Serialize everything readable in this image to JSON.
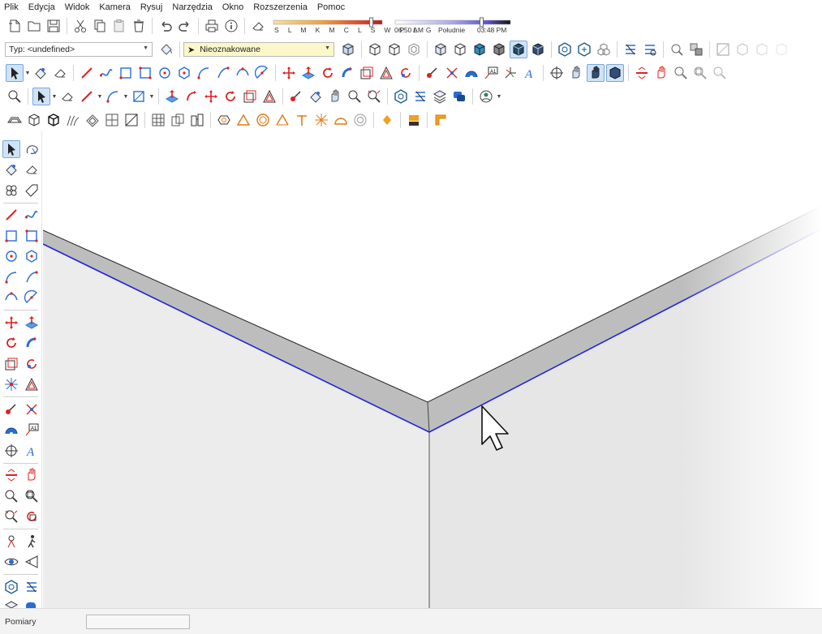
{
  "menu": [
    "Plik",
    "Edycja",
    "Widok",
    "Kamera",
    "Rysuj",
    "Narzędzia",
    "Okno",
    "Rozszerzenia",
    "Pomoc"
  ],
  "shadows": {
    "month_letters": "S L M K M C L S W P L G",
    "time_start": "06:50 AM",
    "time_middle": "Południe",
    "time_end": "03:48 PM",
    "date_slider_level": 0.9,
    "time_slider_level": 0.75
  },
  "style_combo": {
    "value": "Typ: <undefined>"
  },
  "tag_combo": {
    "value": "Nieoznakowane"
  },
  "status": {
    "label": "Pomiary",
    "value": ""
  },
  "colors": {
    "selection_edge": "#2222dd",
    "wall_left": "#ececec",
    "wall_right": "#e6e6e6",
    "wall_top": "#bdbdbd",
    "accent_red": "#e02020",
    "accent_blue": "#2a6bd6"
  },
  "icons": {
    "row1": [
      "new-file-icon",
      "open-folder-icon",
      "save-icon",
      "cut-icon",
      "copy-icon",
      "paste-icon",
      "delete-icon",
      "undo-icon",
      "redo-icon",
      "print-icon",
      "model-info-icon",
      "eraser-icon"
    ],
    "row2": [
      "paint-bucket-icon",
      "style-preview-icon",
      "select-arrow-icon",
      "xray-icon",
      "back-edges-icon",
      "wireframe-icon",
      "hidden-line-icon",
      "shaded-icon",
      "textured-icon",
      "monochrome-icon",
      "section-plane-icon",
      "section-cut-icon",
      "section-fill-icon",
      "camera-icon",
      "component-icon"
    ],
    "row3": [
      "select-icon",
      "paint-icon",
      "eraser-icon",
      "line-icon",
      "freehand-icon",
      "rectangle-icon",
      "rotated-rect-icon",
      "circle-icon",
      "polygon-icon",
      "arc-icon",
      "two-point-arc-icon",
      "three-point-arc-icon",
      "pie-icon",
      "move-icon",
      "push-pull-icon",
      "rotate-icon",
      "follow-me-icon",
      "scale-icon",
      "offset-icon",
      "tape-measure-icon",
      "dimension-icon",
      "protractor-icon",
      "text-icon",
      "axes-icon",
      "3d-text-icon",
      "orbit-icon",
      "pan-icon",
      "zoom-icon",
      "zoom-extents-icon"
    ],
    "row4": [
      "zoom-icon",
      "select-icon",
      "eraser-icon",
      "pencil-icon",
      "arc-icon",
      "rectangle-icon",
      "push-pull-icon",
      "move-icon",
      "rotate-icon",
      "scale-icon",
      "offset-icon",
      "tape-icon",
      "paint-icon",
      "orbit-icon",
      "pan-icon",
      "zoom-window-icon",
      "zoom-extents-icon",
      "warehouse-icon",
      "extension-warehouse-icon",
      "layers-icon",
      "message-icon",
      "account-icon"
    ],
    "row5": [
      "sandbox-icon",
      "box-icon",
      "smoove-icon",
      "stamp-icon",
      "drape-icon",
      "add-detail-icon",
      "flip-edge-icon",
      "solid-outer-shell-icon",
      "intersect-icon",
      "union-icon",
      "subtract-icon",
      "trim-icon",
      "split-icon",
      "ruby-console-icon",
      "diamond-icon",
      "pro-icon",
      "layout-icon"
    ]
  }
}
